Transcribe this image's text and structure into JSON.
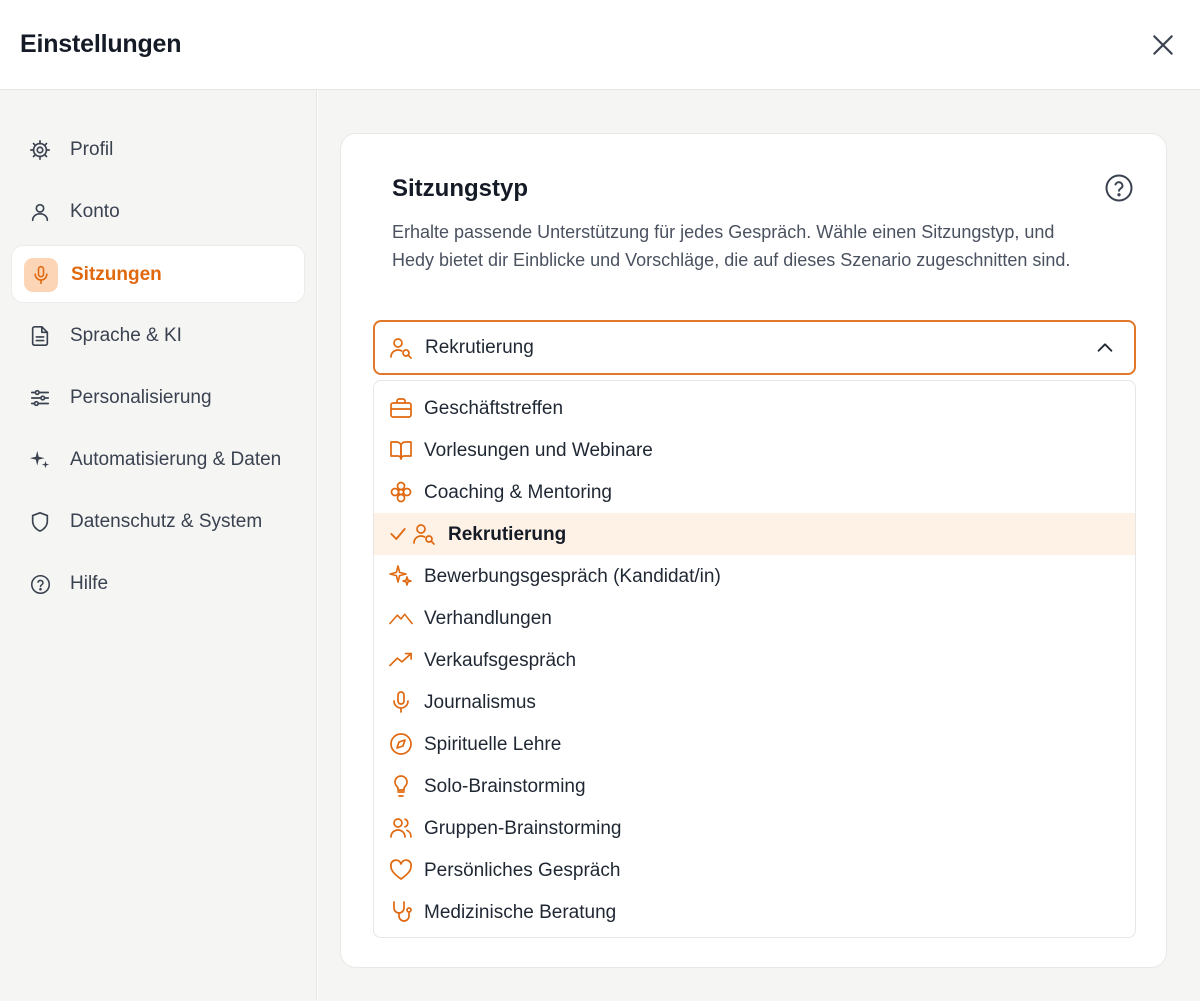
{
  "header": {
    "title": "Einstellungen",
    "close_icon": "close-icon"
  },
  "sidebar": {
    "items": [
      {
        "label": "Profil",
        "icon": "gear-icon",
        "active": false
      },
      {
        "label": "Konto",
        "icon": "user-icon",
        "active": false
      },
      {
        "label": "Sitzungen",
        "icon": "microphone-icon",
        "active": true
      },
      {
        "label": "Sprache & KI",
        "icon": "document-icon",
        "active": false
      },
      {
        "label": "Personalisierung",
        "icon": "sliders-icon",
        "active": false
      },
      {
        "label": "Automatisierung & Daten",
        "icon": "sparkles-icon",
        "active": false
      },
      {
        "label": "Datenschutz & System",
        "icon": "shield-icon",
        "active": false
      },
      {
        "label": "Hilfe",
        "icon": "help-circle-icon",
        "active": false
      }
    ]
  },
  "card": {
    "title": "Sitzungstyp",
    "description": "Erhalte passende Unterstützung für jedes Gespräch. Wähle einen Sitzungstyp, und Hedy bietet dir Einblicke und Vorschläge, die auf dieses Szenario zugeschnitten sind.",
    "select": {
      "value": "Rekrutierung",
      "icon": "user-search-icon",
      "expanded": true
    },
    "options": [
      {
        "label": "Geschäftstreffen",
        "icon": "briefcase-icon"
      },
      {
        "label": "Vorlesungen und Webinare",
        "icon": "book-open-icon"
      },
      {
        "label": "Coaching & Mentoring",
        "icon": "flower-icon"
      },
      {
        "label": "Rekrutierung",
        "icon": "user-search-icon",
        "selected": true
      },
      {
        "label": "Bewerbungsgespräch (Kandidat/in)",
        "icon": "sparkles-icon"
      },
      {
        "label": "Verhandlungen",
        "icon": "mountain-icon"
      },
      {
        "label": "Verkaufsgespräch",
        "icon": "trending-up-icon"
      },
      {
        "label": "Journalismus",
        "icon": "microphone-icon"
      },
      {
        "label": "Spirituelle Lehre",
        "icon": "compass-icon"
      },
      {
        "label": "Solo-Brainstorming",
        "icon": "lightbulb-icon"
      },
      {
        "label": "Gruppen-Brainstorming",
        "icon": "users-icon"
      },
      {
        "label": "Persönliches Gespräch",
        "icon": "heart-icon"
      },
      {
        "label": "Medizinische Beratung",
        "icon": "stethoscope-icon"
      }
    ]
  },
  "colors": {
    "accent": "#e0680f",
    "accent_soft": "#fcd5b6",
    "selected_bg": "#fef1e6",
    "sidebar_bg": "#f5f5f4"
  }
}
